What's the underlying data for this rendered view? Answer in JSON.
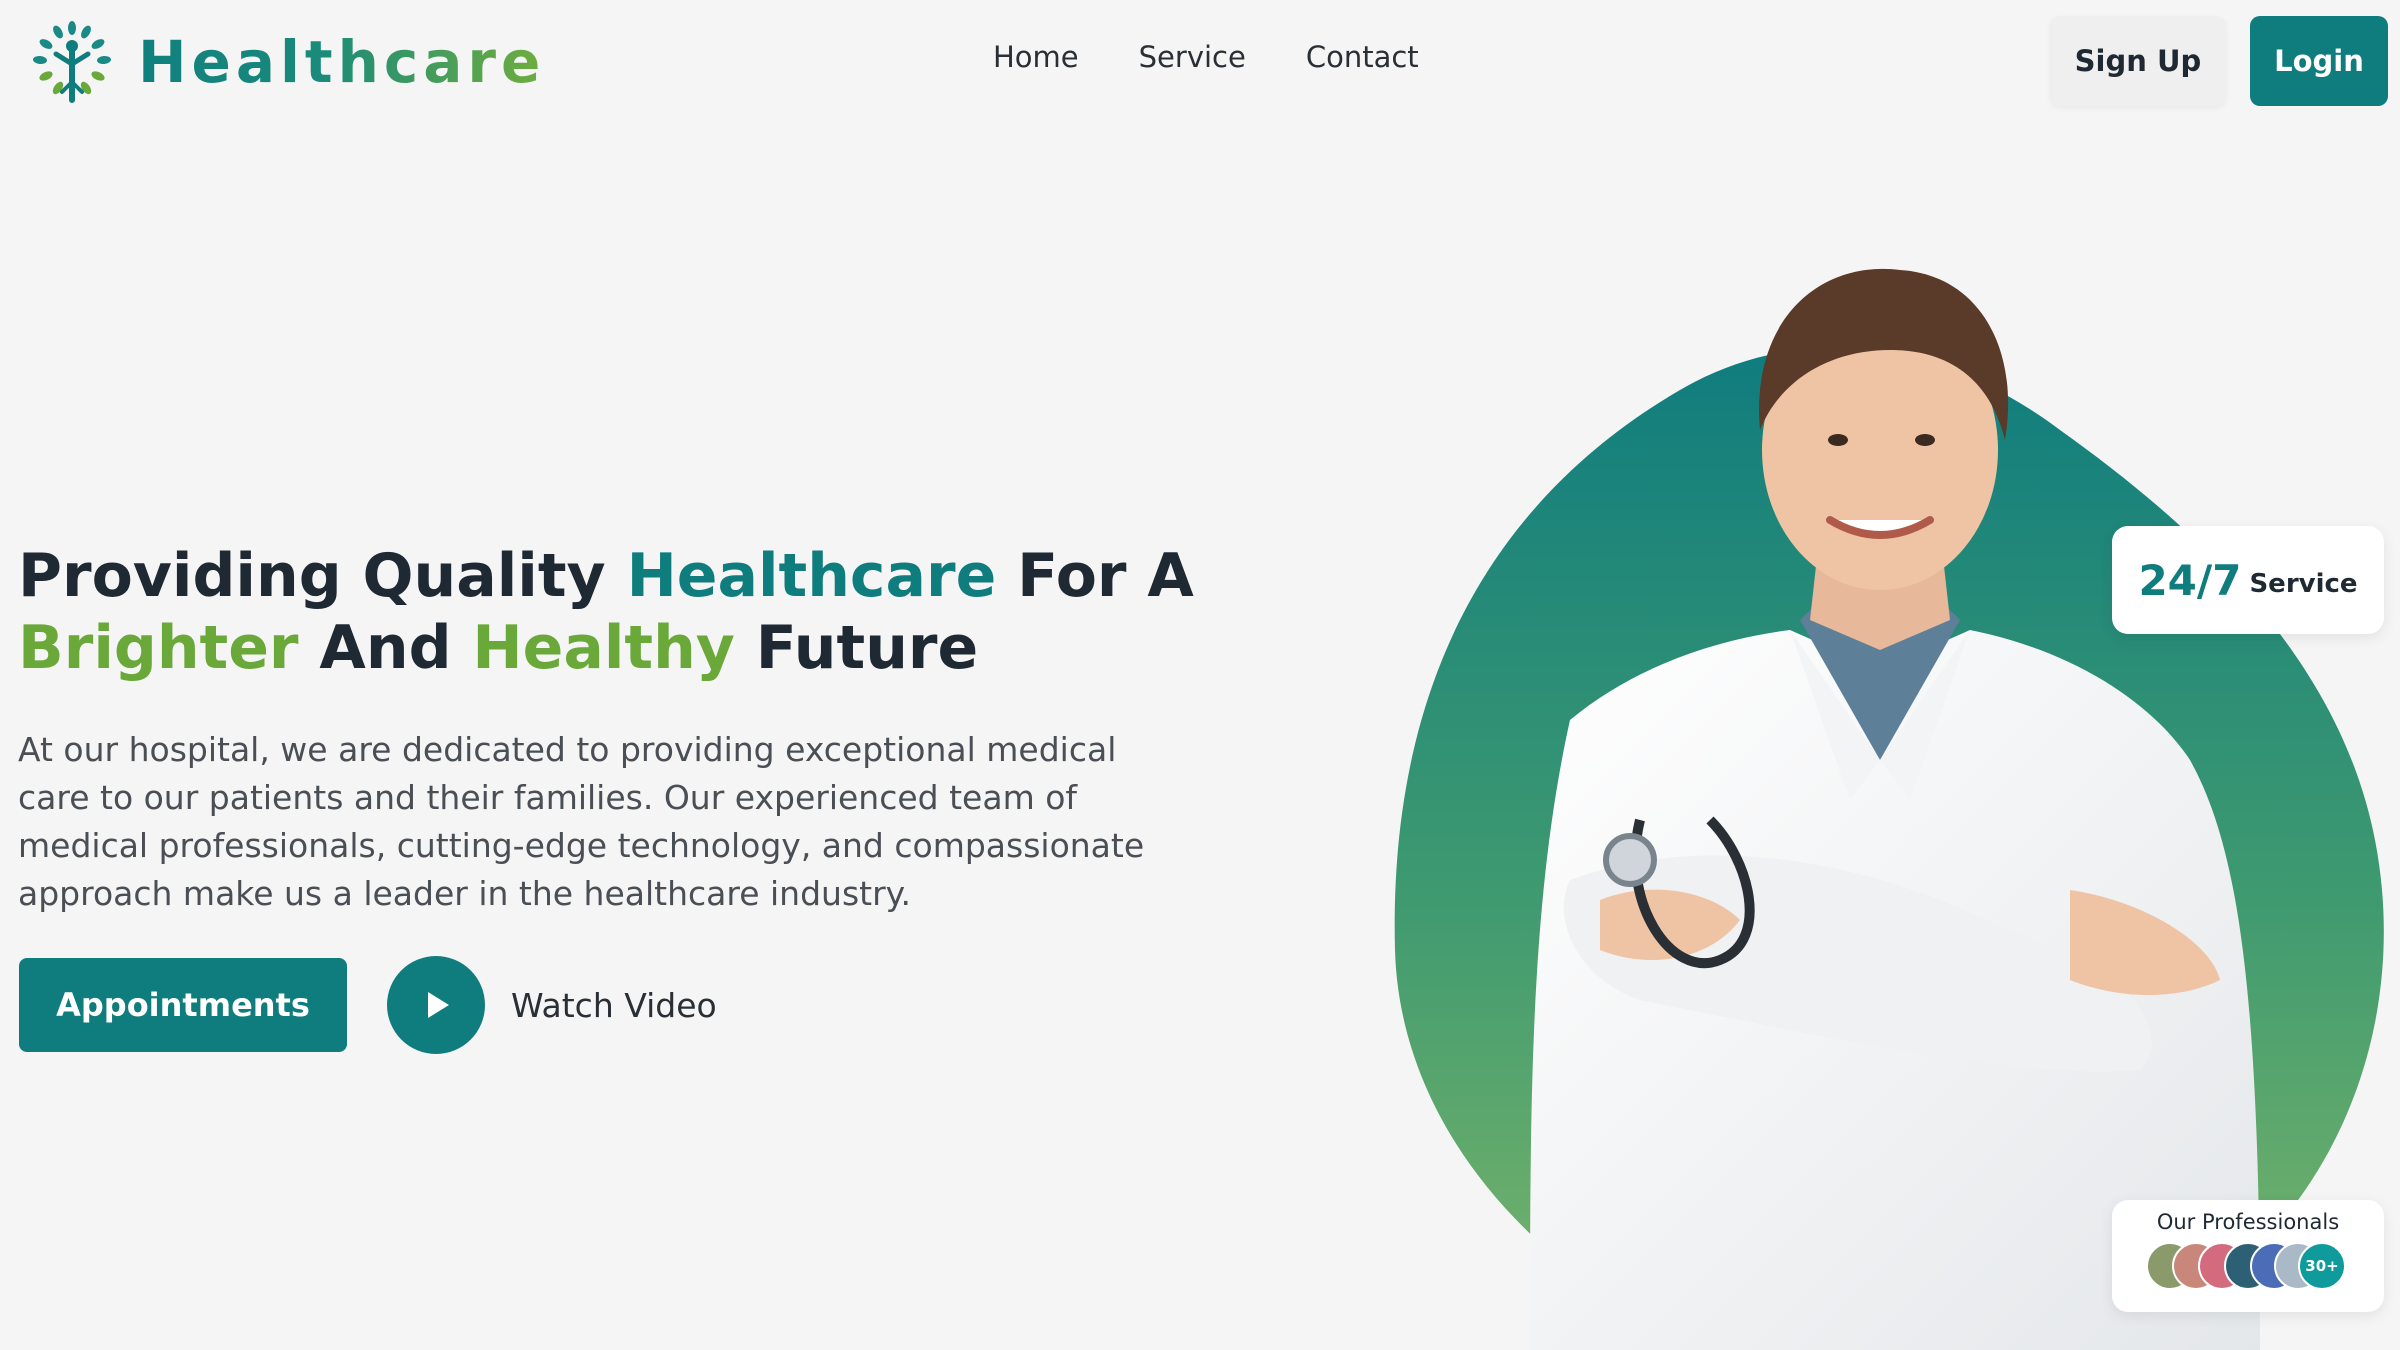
{
  "brand": {
    "name": "Healthcare",
    "logo_icon": "tree-of-life-icon",
    "colors": {
      "teal": "#0f7c7e",
      "green": "#6aa83a"
    }
  },
  "nav": {
    "links": [
      {
        "label": "Home"
      },
      {
        "label": "Service"
      },
      {
        "label": "Contact"
      }
    ],
    "signup_label": "Sign Up",
    "login_label": "Login"
  },
  "hero": {
    "headline": {
      "p1": "Providing Quality ",
      "p2": "Healthcare",
      "p3": " For A",
      "p4": "Brighter",
      "p5": " And ",
      "p6": "Healthy",
      "p7": " Future"
    },
    "description": "At our hospital, we are dedicated to providing exceptional medical care to our patients and their families. Our experienced team of medical professionals, cutting-edge technology, and compassionate approach make us a leader in the healthcare industry.",
    "appointments_label": "Appointments",
    "watch_label": "Watch Video",
    "play_icon": "play-icon",
    "image": "doctor-illustration"
  },
  "badges": {
    "service_big": "24/7",
    "service_small": "Service",
    "professionals_title": "Our Professionals",
    "professionals_count": "30+"
  }
}
